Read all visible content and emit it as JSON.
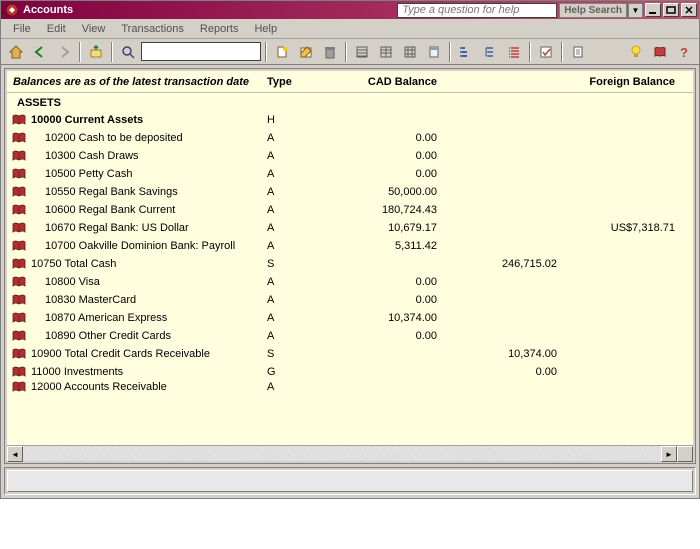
{
  "window": {
    "title": "Accounts",
    "help_placeholder": "Type a question for help",
    "help_search_label": "Help Search"
  },
  "menu": {
    "file": "File",
    "edit": "Edit",
    "view": "View",
    "transactions": "Transactions",
    "reports": "Reports",
    "help": "Help"
  },
  "grid": {
    "status_text": "Balances are as of the latest transaction date",
    "col_type": "Type",
    "col_cad": "CAD Balance",
    "col_foreign": "Foreign Balance",
    "section": "ASSETS",
    "rows": [
      {
        "name": "10000 Current Assets",
        "type": "H",
        "cad": "",
        "sub": "",
        "for": "",
        "bold": true,
        "indent": 1
      },
      {
        "name": "10200 Cash to be deposited",
        "type": "A",
        "cad": "0.00",
        "sub": "",
        "for": "",
        "indent": 2
      },
      {
        "name": "10300 Cash Draws",
        "type": "A",
        "cad": "0.00",
        "sub": "",
        "for": "",
        "indent": 2
      },
      {
        "name": "10500 Petty Cash",
        "type": "A",
        "cad": "0.00",
        "sub": "",
        "for": "",
        "indent": 2
      },
      {
        "name": "10550 Regal Bank Savings",
        "type": "A",
        "cad": "50,000.00",
        "sub": "",
        "for": "",
        "indent": 2
      },
      {
        "name": "10600 Regal Bank Current",
        "type": "A",
        "cad": "180,724.43",
        "sub": "",
        "for": "",
        "indent": 2
      },
      {
        "name": "10670 Regal Bank: US Dollar",
        "type": "A",
        "cad": "10,679.17",
        "sub": "",
        "for": "US$7,318.71",
        "indent": 2
      },
      {
        "name": "10700 Oakville Dominion Bank: Payroll",
        "type": "A",
        "cad": "5,311.42",
        "sub": "",
        "for": "",
        "indent": 2
      },
      {
        "name": "10750 Total Cash",
        "type": "S",
        "cad": "",
        "sub": "246,715.02",
        "for": "",
        "indent": 1
      },
      {
        "name": "10800 Visa",
        "type": "A",
        "cad": "0.00",
        "sub": "",
        "for": "",
        "indent": 2
      },
      {
        "name": "10830 MasterCard",
        "type": "A",
        "cad": "0.00",
        "sub": "",
        "for": "",
        "indent": 2
      },
      {
        "name": "10870 American Express",
        "type": "A",
        "cad": "10,374.00",
        "sub": "",
        "for": "",
        "indent": 2
      },
      {
        "name": "10890 Other Credit Cards",
        "type": "A",
        "cad": "0.00",
        "sub": "",
        "for": "",
        "indent": 2
      },
      {
        "name": "10900 Total Credit Cards Receivable",
        "type": "S",
        "cad": "",
        "sub": "10,374.00",
        "for": "",
        "indent": 1
      },
      {
        "name": "11000 Investments",
        "type": "G",
        "cad": "",
        "sub": "0.00",
        "for": "",
        "indent": 1
      },
      {
        "name": "12000 Accounts Receivable",
        "type": "A",
        "cad": "",
        "sub": "",
        "for": "",
        "indent": 1,
        "cut": true
      }
    ]
  }
}
